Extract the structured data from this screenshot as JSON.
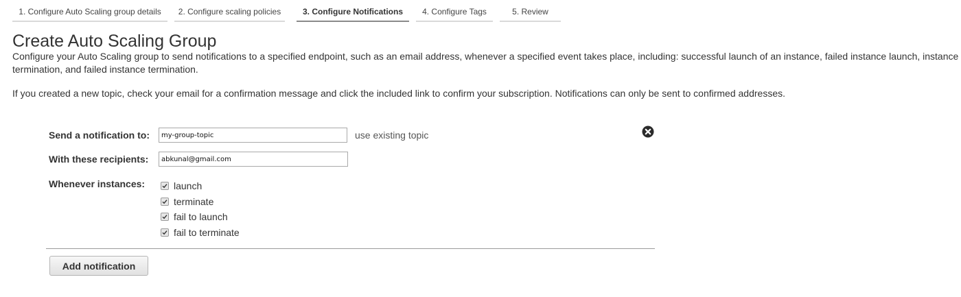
{
  "wizard": {
    "steps": [
      {
        "label": "1. Configure Auto Scaling group details",
        "active": false
      },
      {
        "label": "2. Configure scaling policies",
        "active": false
      },
      {
        "label": "3. Configure Notifications",
        "active": true
      },
      {
        "label": "4. Configure Tags",
        "active": false
      },
      {
        "label": "5. Review",
        "active": false
      }
    ]
  },
  "page": {
    "title": "Create Auto Scaling Group",
    "description": "Configure your Auto Scaling group to send notifications to a specified endpoint, such as an email address, whenever a specified event takes place, including: successful launch of an instance, failed instance launch, instance termination, and failed instance termination.",
    "confirmation_note": "If you created a new topic, check your email for a confirmation message and click the included link to confirm your subscription. Notifications can only be sent to confirmed addresses."
  },
  "notification": {
    "send_to_label": "Send a notification to:",
    "topic_value": "my-group-topic",
    "use_existing_link": "use existing topic",
    "recipients_label": "With these recipients:",
    "recipients_value": "abkunal@gmail.com",
    "whenever_label": "Whenever instances:",
    "events": [
      {
        "label": "launch",
        "checked": true
      },
      {
        "label": "terminate",
        "checked": true
      },
      {
        "label": "fail to launch",
        "checked": true
      },
      {
        "label": "fail to terminate",
        "checked": true
      }
    ],
    "remove_icon": "close-circle-icon"
  },
  "actions": {
    "add_notification_label": "Add notification"
  }
}
